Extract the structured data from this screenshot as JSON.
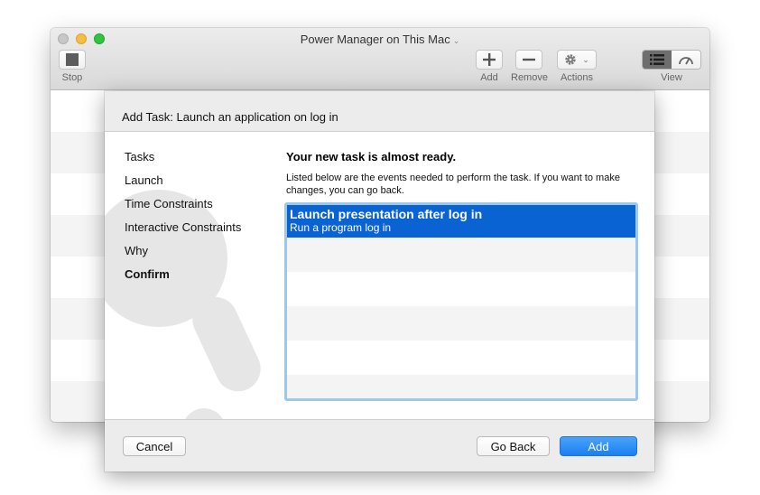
{
  "window": {
    "title": "Power Manager on This Mac"
  },
  "toolbar": {
    "stop_label": "Stop",
    "add_label": "Add",
    "remove_label": "Remove",
    "actions_label": "Actions",
    "view_label": "View",
    "icons": {
      "stop": "stop-icon",
      "add": "plus-icon",
      "remove": "minus-icon",
      "actions": "gear-icon",
      "view_list": "list-icon",
      "view_gauge": "gauge-icon"
    }
  },
  "sheet": {
    "title": "Add Task: Launch an application on log in",
    "steps": [
      {
        "label": "Tasks"
      },
      {
        "label": "Launch"
      },
      {
        "label": "Time Constraints"
      },
      {
        "label": "Interactive Constraints"
      },
      {
        "label": "Why"
      },
      {
        "label": "Confirm"
      }
    ],
    "current_step": "Confirm",
    "heading": "Your new task is almost ready.",
    "description": "Listed below are the events needed to perform the task. If you want to make changes, you can go back.",
    "events": [
      {
        "title": "Launch presentation after log in",
        "subtitle": "Run a program log in"
      }
    ],
    "buttons": {
      "cancel": "Cancel",
      "back": "Go Back",
      "add": "Add"
    }
  },
  "colors": {
    "accent": "#0a63d2",
    "primary_button": "#1a7ff0",
    "list_focus_ring": "#9cc7ee"
  }
}
